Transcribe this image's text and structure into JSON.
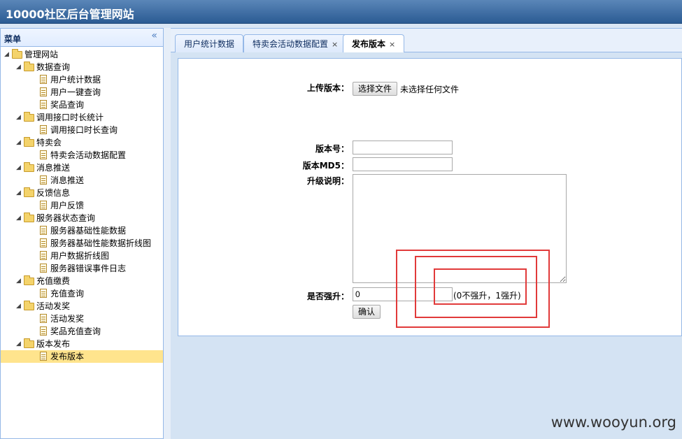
{
  "app": {
    "title": "10000社区后台管理网站"
  },
  "sidebar": {
    "title": "菜单",
    "collapse_icon": "«",
    "tree": [
      {
        "label": "管理网站",
        "level": 0,
        "type": "folder"
      },
      {
        "label": "数据查询",
        "level": 1,
        "type": "folder"
      },
      {
        "label": "用户统计数据",
        "level": 2,
        "type": "file"
      },
      {
        "label": "用户一键查询",
        "level": 2,
        "type": "file"
      },
      {
        "label": "奖品查询",
        "level": 2,
        "type": "file"
      },
      {
        "label": "调用接口时长统计",
        "level": 1,
        "type": "folder"
      },
      {
        "label": "调用接口时长查询",
        "level": 2,
        "type": "file"
      },
      {
        "label": "特卖会",
        "level": 1,
        "type": "folder"
      },
      {
        "label": "特卖会活动数据配置",
        "level": 2,
        "type": "file"
      },
      {
        "label": "消息推送",
        "level": 1,
        "type": "folder"
      },
      {
        "label": "消息推送",
        "level": 2,
        "type": "file"
      },
      {
        "label": "反馈信息",
        "level": 1,
        "type": "folder"
      },
      {
        "label": "用户反馈",
        "level": 2,
        "type": "file"
      },
      {
        "label": "服务器状态查询",
        "level": 1,
        "type": "folder"
      },
      {
        "label": "服务器基础性能数据",
        "level": 2,
        "type": "file"
      },
      {
        "label": "服务器基础性能数据折线图",
        "level": 2,
        "type": "file"
      },
      {
        "label": "用户数据折线图",
        "level": 2,
        "type": "file"
      },
      {
        "label": "服务器错误事件日志",
        "level": 2,
        "type": "file"
      },
      {
        "label": "充值缴费",
        "level": 1,
        "type": "folder"
      },
      {
        "label": "充值查询",
        "level": 2,
        "type": "file"
      },
      {
        "label": "活动发奖",
        "level": 1,
        "type": "folder"
      },
      {
        "label": "活动发奖",
        "level": 2,
        "type": "file"
      },
      {
        "label": "奖品充值查询",
        "level": 2,
        "type": "file"
      },
      {
        "label": "版本发布",
        "level": 1,
        "type": "folder"
      },
      {
        "label": "发布版本",
        "level": 2,
        "type": "file",
        "selected": true
      }
    ]
  },
  "tabs": [
    {
      "label": "用户统计数据",
      "closable": false
    },
    {
      "label": "特卖会活动数据配置",
      "closable": true
    },
    {
      "label": "发布版本",
      "closable": true,
      "active": true
    }
  ],
  "form": {
    "upload_label": "上传版本：",
    "choose_file_button": "选择文件",
    "no_file_text": "未选择任何文件",
    "version_label": "版本号：",
    "version_value": "",
    "md5_label": "版本MD5：",
    "md5_value": "",
    "desc_label": "升级说明：",
    "desc_value": "",
    "force_label": "是否强升：",
    "force_value": "0",
    "force_hint": "(0不强升，1强升)",
    "confirm_button": "确认"
  },
  "watermark": "www.wooyun.org",
  "annotation_color": "#e13a3a"
}
